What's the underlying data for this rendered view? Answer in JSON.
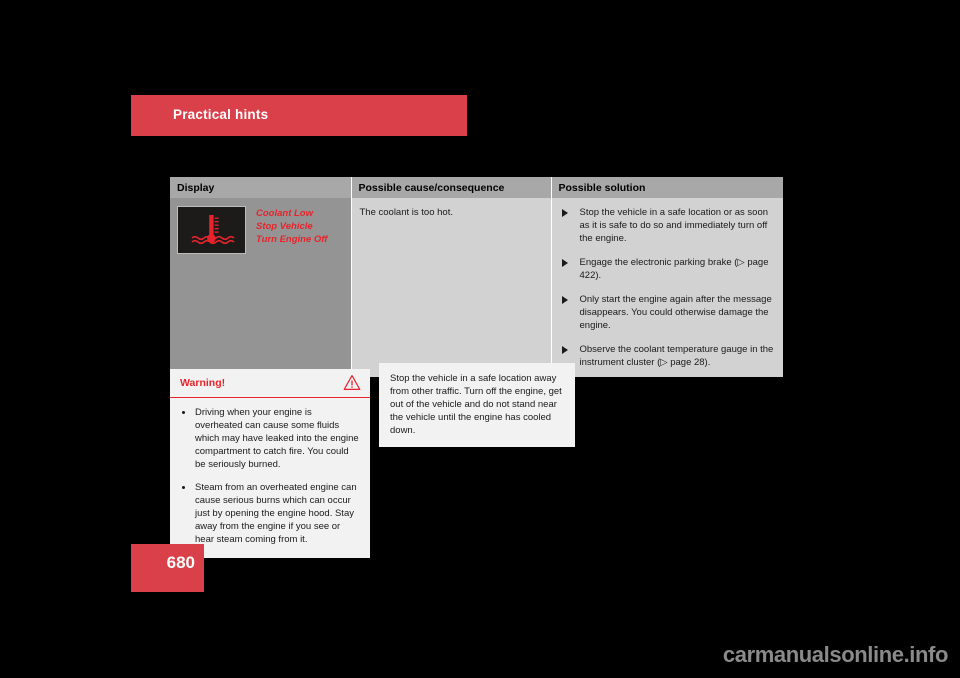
{
  "banner": {
    "chapter_title": "Practical hints",
    "color": "#d9404a"
  },
  "page_footer": {
    "page_number": "680",
    "block_color": "#d9404a"
  },
  "watermark": {
    "text": "carmanualsonline.info"
  },
  "table": {
    "headers": {
      "display": "Display",
      "cause": "Possible cause/consequence",
      "solution": "Possible solution"
    },
    "row": {
      "symbol_icon": "coolant-temperature-warning-icon",
      "display_message_lines": [
        "Coolant Low",
        "Stop Vehicle",
        "Turn Engine Off"
      ],
      "display_message_color": "#e8232c",
      "cause_text": "The coolant is too hot.",
      "solutions": [
        "Stop the vehicle in a safe location or as soon as it is safe to do so and immediately turn off the engine.",
        "Engage the electronic parking brake (▷ page 422).",
        "Only start the engine again after the message disappears. You could otherwise damage the engine.",
        "Observe the coolant temperature gauge in the instrument cluster (▷ page 28)."
      ]
    }
  },
  "warning_box": {
    "title": "Warning!",
    "icon": "warning-triangle-icon",
    "accent_color": "#e8232c",
    "items": [
      "Driving when your engine is overheated can cause some fluids which may have leaked into the engine compartment to catch fire. You could be seriously burned.",
      "Steam from an overheated engine can cause serious burns which can occur just by opening the engine hood. Stay away from the engine if you see or hear steam coming from it."
    ]
  },
  "note_box": {
    "text": "Stop the vehicle in a safe location away from other traffic. Turn off the engine, get out of the vehicle and do not stand near the vehicle until the engine has cooled down."
  }
}
